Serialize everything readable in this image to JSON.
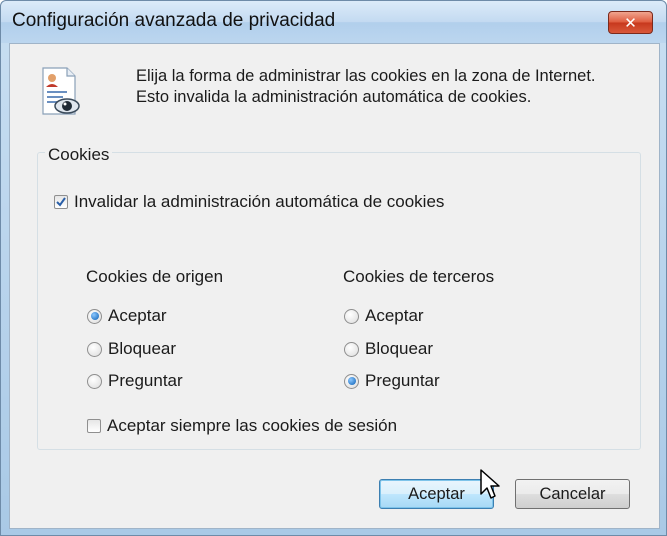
{
  "window": {
    "title": "Configuración avanzada de privacidad",
    "close_label": "✕"
  },
  "intro": {
    "line1": "Elija la forma de administrar las cookies en la zona de Internet.",
    "line2": "Esto invalida la administración automática de cookies.",
    "icon": "document-eye-icon"
  },
  "cookies_group": {
    "legend": "Cookies",
    "override": {
      "label": "Invalidar la administración automática de cookies",
      "checked": true
    },
    "first_party": {
      "heading": "Cookies de origen",
      "options": [
        "Aceptar",
        "Bloquear",
        "Preguntar"
      ],
      "selected": "Aceptar"
    },
    "third_party": {
      "heading": "Cookies de terceros",
      "options": [
        "Aceptar",
        "Bloquear",
        "Preguntar"
      ],
      "selected": "Preguntar"
    },
    "session": {
      "label": "Aceptar siempre las cookies de sesión",
      "checked": false
    }
  },
  "buttons": {
    "ok": "Aceptar",
    "cancel": "Cancelar"
  },
  "colors": {
    "title_bar": "#c3daf1",
    "close_button": "#df5a3c",
    "radio_selected": "#0b5fb4",
    "checkmark": "#2a5fa8"
  }
}
